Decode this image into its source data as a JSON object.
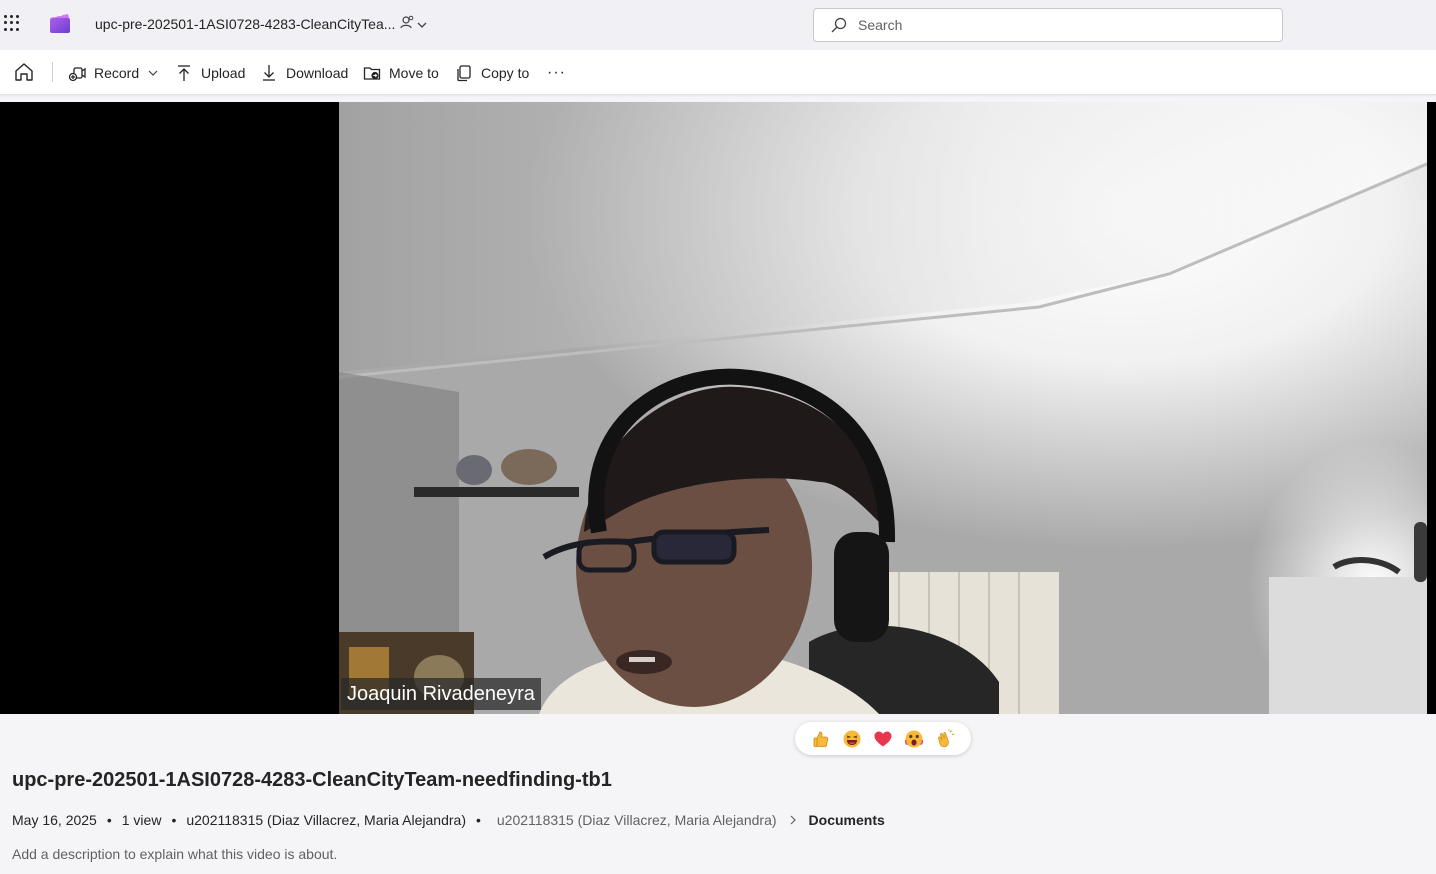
{
  "header": {
    "file_title": "upc-pre-202501-1ASI0728-4283-CleanCityTea...",
    "search_placeholder": "Search"
  },
  "toolbar": {
    "record_label": "Record",
    "upload_label": "Upload",
    "download_label": "Download",
    "move_label": "Move to",
    "copy_label": "Copy to",
    "more_label": "···"
  },
  "video": {
    "participant_name": "Joaquin Rivadeneyra"
  },
  "reactions": [
    {
      "name": "thumbs-up-icon"
    },
    {
      "name": "laugh-icon"
    },
    {
      "name": "heart-icon"
    },
    {
      "name": "surprised-icon"
    },
    {
      "name": "clap-icon"
    }
  ],
  "details": {
    "title": "upc-pre-202501-1ASI0728-4283-CleanCityTeam-needfinding-tb1",
    "date": "May 16, 2025",
    "views": "1 view",
    "owner": "u202118315 (Diaz Villacrez, Maria Alejandra)",
    "breadcrumb_owner": "u202118315 (Diaz Villacrez, Maria Alejandra)",
    "breadcrumb_current": "Documents",
    "description_placeholder": "Add a description to explain what this video is about."
  },
  "colors": {
    "accent": "#5b5fc7",
    "heart": "#e8364c",
    "emoji": "#f8b93a"
  }
}
